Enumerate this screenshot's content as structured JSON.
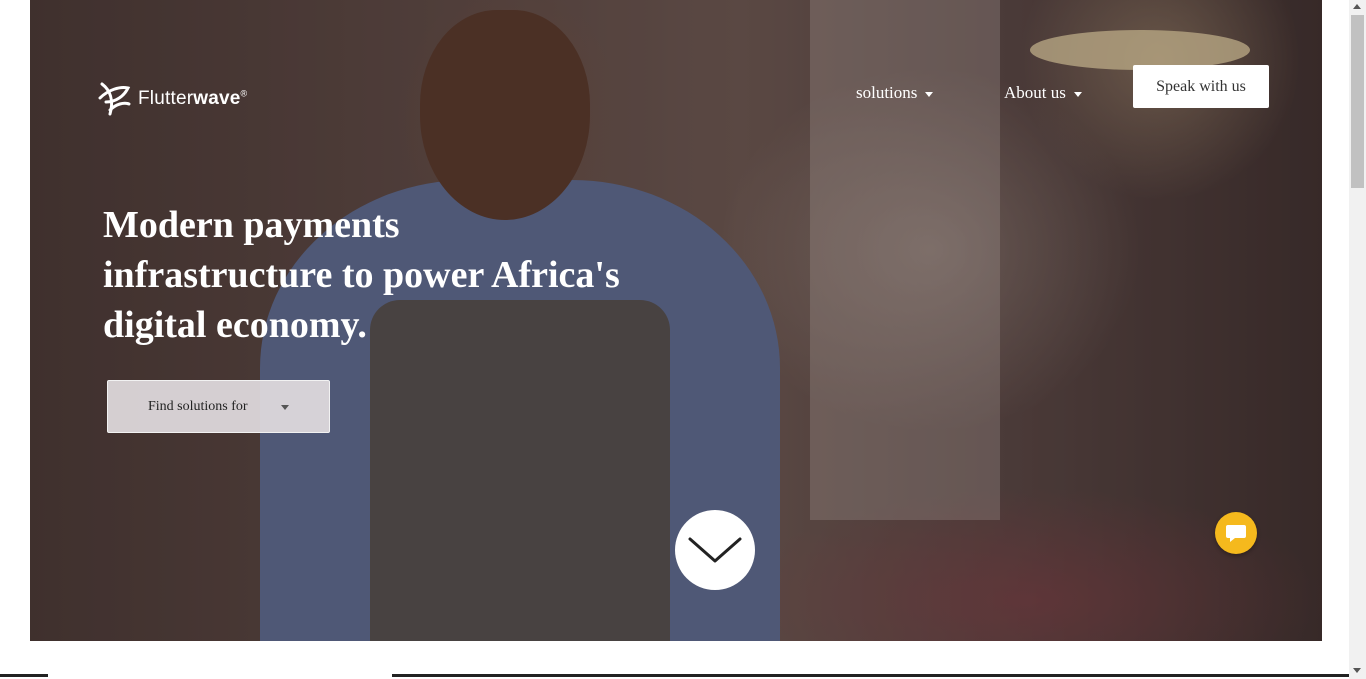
{
  "brand": {
    "name_light": "Flutter",
    "name_bold": "wave",
    "registered": "®",
    "logo_icon": "flutterwave-logo-icon"
  },
  "nav": {
    "solutions_label": "solutions",
    "about_label": "About us",
    "cta_label": "Speak with us",
    "dropdown_icon": "caret-down-icon"
  },
  "hero": {
    "headline_line1": "Modern payments",
    "headline_line2": "infrastructure to power Africa's",
    "headline_line3": "digital economy.",
    "find_label": "Find solutions for",
    "scroll_icon": "chevron-down-icon",
    "chat_icon": "chat-bubble-icon"
  },
  "colors": {
    "chat_accent": "#f5b91d",
    "headline_text": "#ffffff",
    "button_bg": "#ffffff"
  }
}
